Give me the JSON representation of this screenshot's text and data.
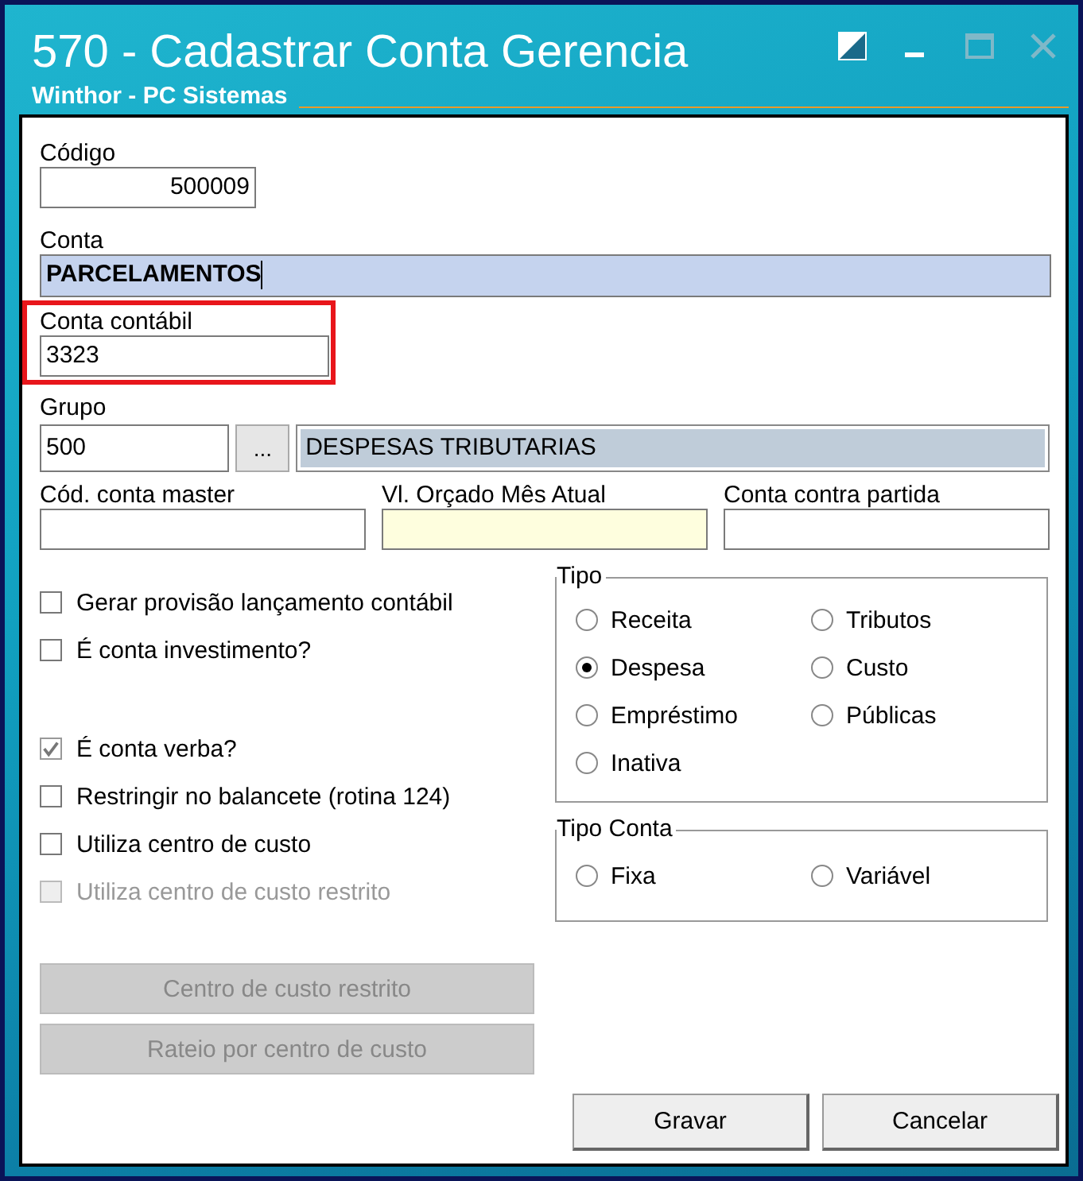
{
  "window": {
    "title": "570 - Cadastrar Conta Gerencia",
    "subtitle": "Winthor - PC Sistemas"
  },
  "codigo": {
    "label": "Código",
    "value": "500009"
  },
  "conta": {
    "label": "Conta",
    "value": "PARCELAMENTOS"
  },
  "conta_contabil": {
    "label": "Conta contábil",
    "value": "3323",
    "highlighted": true
  },
  "grupo": {
    "label": "Grupo",
    "value": "500",
    "lookup_button": "...",
    "description": "DESPESAS TRIBUTARIAS"
  },
  "row_fields": [
    {
      "label": "Cód. conta master",
      "kind": "plain"
    },
    {
      "label": "Vl. Orçado Mês Atual",
      "kind": "required"
    },
    {
      "label": "Conta contra partida",
      "kind": "plain"
    }
  ],
  "checks_top": [
    {
      "label": "Gerar provisão lançamento contábil",
      "checked": false,
      "disabled": false
    },
    {
      "label": "É conta investimento?",
      "checked": false,
      "disabled": false
    }
  ],
  "checks_bottom": [
    {
      "label": "É conta verba?",
      "checked": true,
      "disabled": false
    },
    {
      "label": "Restringir no balancete (rotina 124)",
      "checked": false,
      "disabled": false
    },
    {
      "label": "Utiliza centro de custo",
      "checked": false,
      "disabled": false
    },
    {
      "label": "Utiliza centro de custo restrito",
      "checked": false,
      "disabled": true
    }
  ],
  "tipo": {
    "title": "Tipo",
    "options": [
      {
        "label": "Receita",
        "selected": false
      },
      {
        "label": "Tributos",
        "selected": false
      },
      {
        "label": "Despesa",
        "selected": true
      },
      {
        "label": "Custo",
        "selected": false
      },
      {
        "label": "Empréstimo",
        "selected": false
      },
      {
        "label": "Públicas",
        "selected": false
      },
      {
        "label": "Inativa",
        "selected": false
      }
    ]
  },
  "tipo_conta": {
    "title": "Tipo Conta",
    "options": [
      {
        "label": "Fixa",
        "selected": false
      },
      {
        "label": "Variável",
        "selected": false
      }
    ]
  },
  "side_buttons": [
    {
      "label": "Centro de custo restrito",
      "disabled": true
    },
    {
      "label": "Rateio por centro de custo",
      "disabled": true
    }
  ],
  "buttons": [
    {
      "label": "Gravar"
    },
    {
      "label": "Cancelar"
    }
  ]
}
